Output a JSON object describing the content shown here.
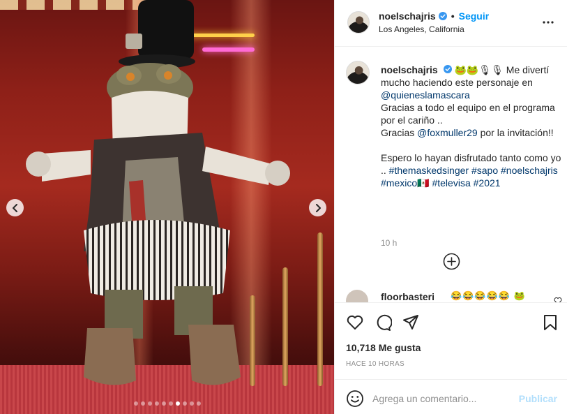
{
  "post": {
    "username": "noelschajris",
    "separator": "•",
    "follow_label": "Seguir",
    "location": "Los Angeles, California",
    "icons": {
      "verified": "verified-badge-icon",
      "more": "more-options-icon",
      "prev": "chevron-left-icon",
      "next": "chevron-right-icon",
      "add_comments": "plus-circle-icon",
      "like": "heart-icon",
      "comment": "comment-bubble-icon",
      "share": "paper-plane-icon",
      "save": "bookmark-icon",
      "emoji": "smiley-icon"
    },
    "colors": {
      "accent": "#0095f6",
      "link": "#00376b",
      "publish_disabled": "#b2dffc",
      "muted": "#8e8e8e"
    }
  },
  "carousel": {
    "slide_count": 10,
    "active_index": 6
  },
  "caption": {
    "username": "noelschajris",
    "emojis": "🐸🐸🎙🎙",
    "line1": " Me divertí mucho haciendo este personaje en ",
    "mention1": "@quieneslamascara",
    "line2": "Gracias a todo el equipo en el programa por el cariño ..",
    "line3_pre": "Gracias ",
    "mention2": "@foxmuller29",
    "line3_post": " por la invitación!!",
    "line4_pre": "Espero lo hayan disfrutado tanto como yo .. ",
    "tag1": "#themaskedsinger",
    "tag2": "#sapo",
    "tag3": "#noelschajris",
    "tag4": "#mexico",
    "flag": "🇲🇽",
    "tag5": "#televisa",
    "tag6": "#2021",
    "time": "10 h"
  },
  "comment": {
    "username": "floorbasteri",
    "emojis": "😂😂😂😂😂 🐸"
  },
  "stats": {
    "likes": "10,718 Me gusta",
    "ago": "HACE 10 HORAS"
  },
  "composer": {
    "placeholder": "Agrega un comentario...",
    "publish_label": "Publicar"
  }
}
